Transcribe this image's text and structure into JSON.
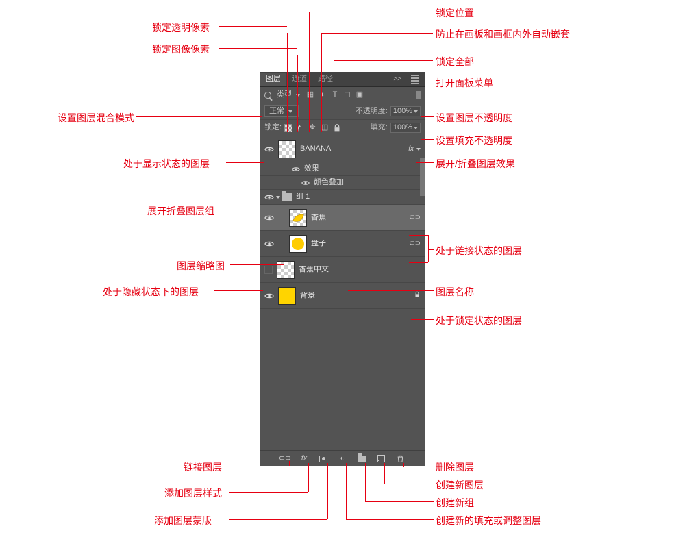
{
  "tabs": {
    "layers": "图层",
    "channels": "通道",
    "paths": "路径"
  },
  "collapse_glyph": ">>",
  "filter": {
    "label": "类型"
  },
  "blend": {
    "mode": "正常",
    "opacity_label": "不透明度:",
    "opacity_value": "100%"
  },
  "locks": {
    "prefix": "锁定:",
    "fill_label": "填充:",
    "fill_value": "100%"
  },
  "layers": {
    "banana_en": "BANANA",
    "effects": "效果",
    "color_overlay": "颜色叠加",
    "group1": "组 1",
    "banana_cn_item": "香蕉",
    "plate": "盘子",
    "banana_cn_text": "香蕉中文",
    "background": "背景",
    "fx": "fx",
    "link_glyph": "⊂⊃",
    "lock_glyph": "🔒"
  },
  "callouts": {
    "lock_transparent": "锁定透明像素",
    "lock_image": "锁定图像像素",
    "lock_position": "锁定位置",
    "prevent_nest": "防止在画板和画框内外自动嵌套",
    "lock_all": "锁定全部",
    "open_panel_menu": "打开面板菜单",
    "blend_mode": "设置图层混合模式",
    "layer_opacity": "设置图层不透明度",
    "fill_opacity": "设置填充不透明度",
    "visible_layer": "处于显示状态的图层",
    "fx_toggle": "展开/折叠图层效果",
    "group_toggle": "展开折叠图层组",
    "thumbnail": "图层缩略图",
    "linked_layer": "处于链接状态的图层",
    "hidden_layer": "处于隐藏状态下的图层",
    "layer_name": "图层名称",
    "locked_layer": "处于锁定状态的图层",
    "link_layers": "链接图层",
    "add_style": "添加图层样式",
    "add_mask": "添加图层蒙版",
    "new_fill_adjust": "创建新的填充或调整图层",
    "new_group": "创建新组",
    "new_layer": "创建新图层",
    "delete_layer": "删除图层"
  }
}
